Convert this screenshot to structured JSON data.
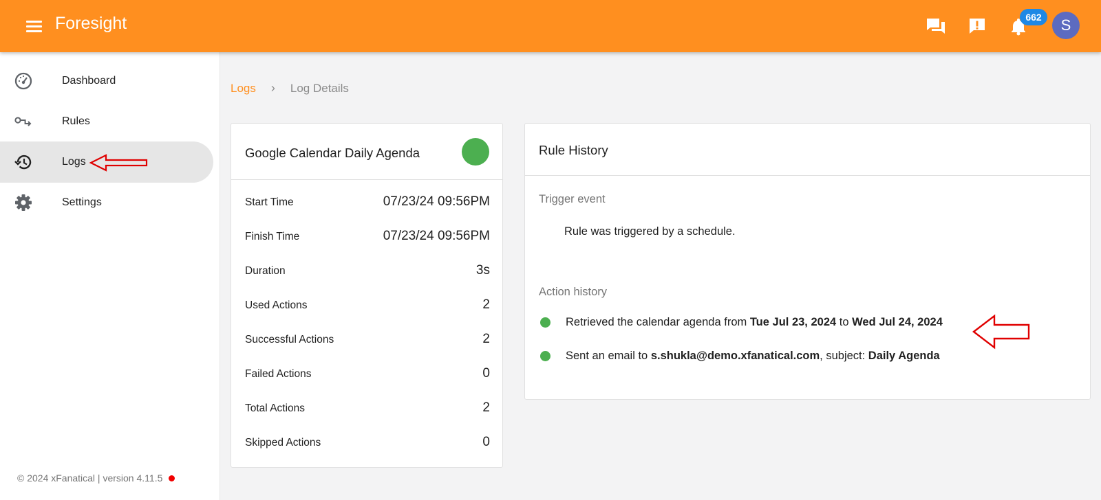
{
  "app": {
    "title": "Foresight",
    "notification_count": "662",
    "avatar_initial": "S"
  },
  "sidebar": {
    "items": [
      {
        "label": "Dashboard",
        "icon": "speedometer-icon"
      },
      {
        "label": "Rules",
        "icon": "rule-flow-icon"
      },
      {
        "label": "Logs",
        "icon": "history-icon",
        "active": true
      },
      {
        "label": "Settings",
        "icon": "gear-icon"
      }
    ],
    "footer": "© 2024 xFanatical | version 4.11.5"
  },
  "breadcrumb": {
    "parent": "Logs",
    "separator": "›",
    "current": "Log Details"
  },
  "log_summary": {
    "rule_name": "Google Calendar Daily Agenda",
    "status_color": "#4caf50",
    "rows": [
      {
        "label": "Start Time",
        "value": "07/23/24 09:56PM"
      },
      {
        "label": "Finish Time",
        "value": "07/23/24 09:56PM"
      },
      {
        "label": "Duration",
        "value": "3s"
      },
      {
        "label": "Used Actions",
        "value": "2"
      },
      {
        "label": "Successful Actions",
        "value": "2"
      },
      {
        "label": "Failed Actions",
        "value": "0"
      },
      {
        "label": "Total Actions",
        "value": "2"
      },
      {
        "label": "Skipped Actions",
        "value": "0"
      }
    ]
  },
  "rule_history": {
    "title": "Rule History",
    "trigger_label": "Trigger event",
    "trigger_text": "Rule was triggered by a schedule.",
    "action_label": "Action history",
    "actions": [
      {
        "text1": "Retrieved the calendar agenda from ",
        "bold1": "Tue Jul 23, 2024",
        "text2": " to ",
        "bold2": "Wed Jul 24, 2024"
      },
      {
        "text1": "Sent an email to ",
        "bold1": "s.shukla@demo.xfanatical.com",
        "text2": ", subject: ",
        "bold2": "Daily Agenda"
      }
    ]
  },
  "colors": {
    "brand": "#ff8f1f",
    "success": "#4caf50",
    "badge": "#1e88e5",
    "annotation": "#e00000"
  }
}
